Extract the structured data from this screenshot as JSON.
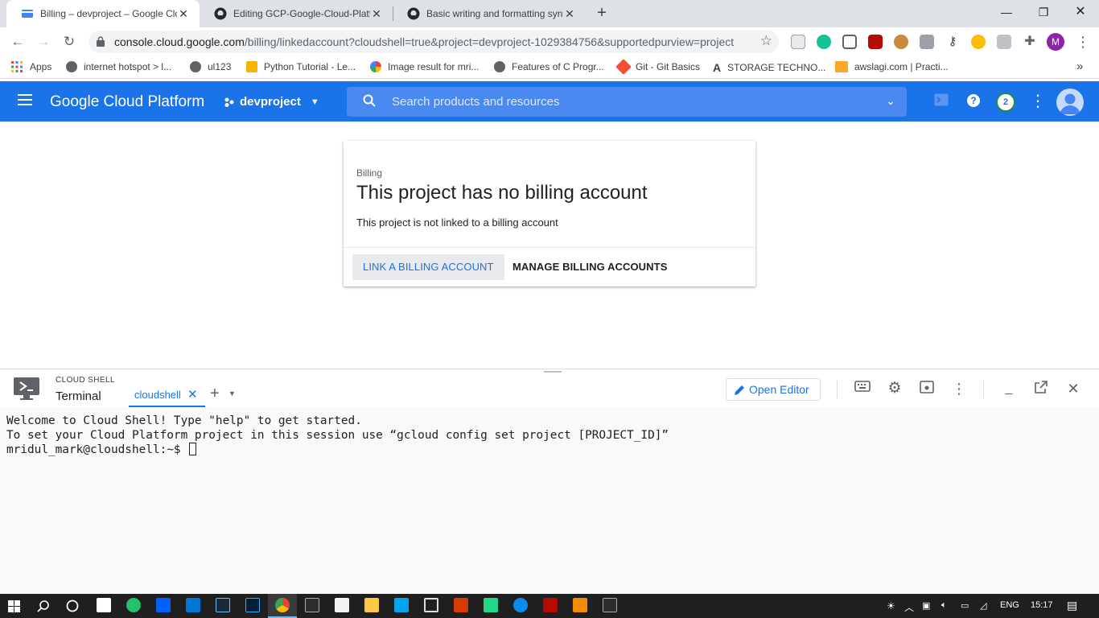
{
  "browser": {
    "tabs": [
      {
        "title": "Billing – devproject – Google Clo",
        "active": true
      },
      {
        "title": "Editing GCP-Google-Cloud-Platfo",
        "active": false
      },
      {
        "title": "Basic writing and formatting synt",
        "active": false
      }
    ],
    "url_host": "console.cloud.google.com",
    "url_path": "/billing/linkedaccount?cloudshell=true&project=devproject-1029384756&supportedpurview=project",
    "profile_initial": "M",
    "bookmarks": [
      {
        "label": "Apps"
      },
      {
        "label": "internet hotspot > l..."
      },
      {
        "label": "ul123"
      },
      {
        "label": "Python Tutorial - Le..."
      },
      {
        "label": "Image result for mri..."
      },
      {
        "label": "Features of C Progr..."
      },
      {
        "label": "Git - Git Basics"
      },
      {
        "label": "STORAGE TECHNO..."
      },
      {
        "label": "awslagi.com | Practi..."
      }
    ],
    "bookmarks_overflow": "»"
  },
  "gcp": {
    "title": "Google Cloud Platform",
    "project": "devproject",
    "search_placeholder": "Search products and resources",
    "notification_count": "2",
    "brand_color": "#1a73e8"
  },
  "billing_card": {
    "eyebrow": "Billing",
    "title": "This project has no billing account",
    "description": "This project is not linked to a billing account",
    "link_button": "LINK A BILLING ACCOUNT",
    "manage_button": "MANAGE BILLING ACCOUNTS"
  },
  "cloud_shell": {
    "eyebrow": "CLOUD SHELL",
    "label": "Terminal",
    "tab_name": "cloudshell",
    "open_editor": "Open Editor",
    "terminal_lines": [
      "Welcome to Cloud Shell! Type \"help\" to get started.",
      "To set your Cloud Platform project in this session use “gcloud config set project [PROJECT_ID]”"
    ],
    "prompt": "mridul_mark@cloudshell:~$ "
  },
  "taskbar": {
    "language": "ENG",
    "time": "15:17"
  }
}
